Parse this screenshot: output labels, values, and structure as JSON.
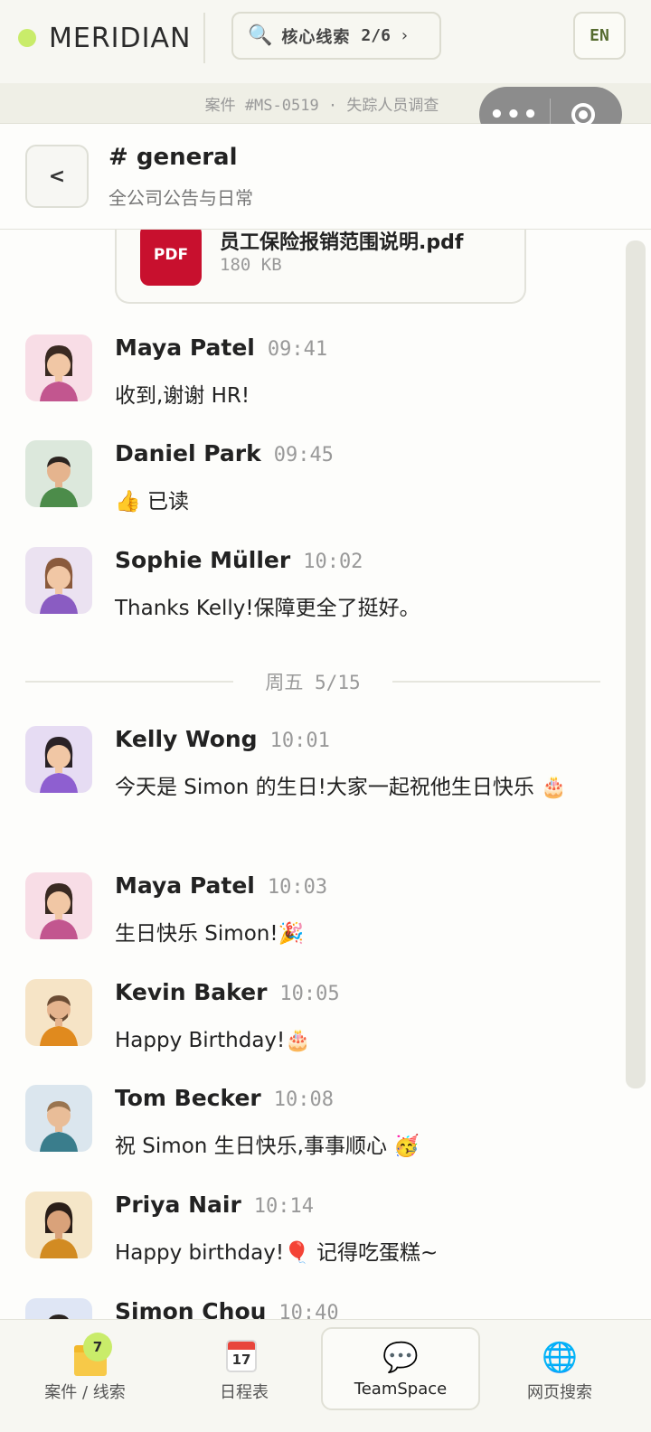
{
  "app": {
    "brand": "MERIDIAN",
    "clue_label": "核心线索",
    "clue_count": "2/6",
    "language": "EN",
    "case_line": "案件 #MS-0519 · 失踪人员调查"
  },
  "channel": {
    "name": "# general",
    "description": "全公司公告与日常"
  },
  "attachment": {
    "badge": "PDF",
    "file_name": "员工保险报销范围说明.pdf",
    "file_size": "180 KB"
  },
  "messages": [
    {
      "author": "Maya Patel",
      "time": "09:41",
      "text": "收到,谢谢 HR!"
    },
    {
      "author": "Daniel Park",
      "time": "09:45",
      "text": "👍 已读"
    },
    {
      "author": "Sophie Müller",
      "time": "10:02",
      "text": "Thanks Kelly!保障更全了挺好。"
    },
    {
      "author": "Kelly Wong",
      "time": "10:01",
      "text": "今天是 Simon 的生日!大家一起祝他生日快乐 🎂"
    },
    {
      "author": "Maya Patel",
      "time": "10:03",
      "text": "生日快乐 Simon!🎉"
    },
    {
      "author": "Kevin Baker",
      "time": "10:05",
      "text": "Happy Birthday!🎂"
    },
    {
      "author": "Tom Becker",
      "time": "10:08",
      "text": "祝 Simon 生日快乐,事事顺心 🥳"
    },
    {
      "author": "Priya Nair",
      "time": "10:14",
      "text": "Happy birthday!🎈 记得吃蛋糕~"
    },
    {
      "author": "Simon Chou",
      "time": "10:40",
      "text": ""
    }
  ],
  "date_separator": "周五 5/15",
  "nav": {
    "cases_label": "案件 / 线索",
    "cases_badge": "7",
    "calendar_label": "日程表",
    "calendar_day": "17",
    "teamspace_label": "TeamSpace",
    "websearch_label": "网页搜索"
  }
}
